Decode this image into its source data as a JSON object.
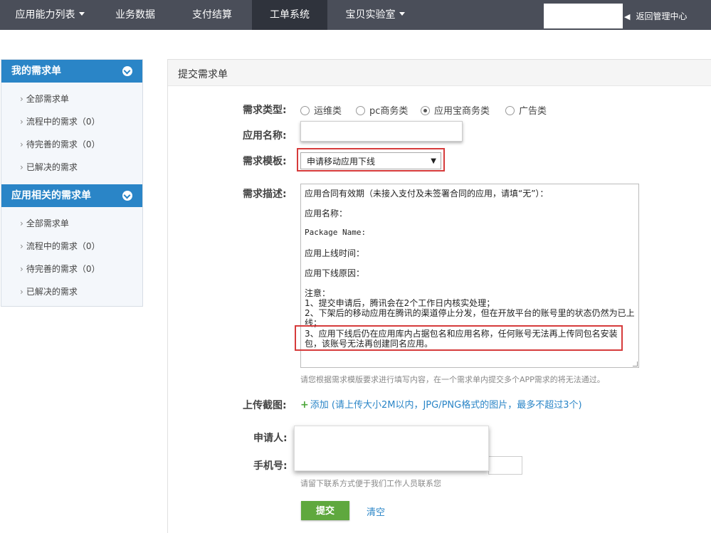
{
  "topnav": {
    "items": [
      {
        "label": "应用能力列表",
        "dropdown": true
      },
      {
        "label": "业务数据",
        "dropdown": false
      },
      {
        "label": "支付结算",
        "dropdown": false
      },
      {
        "label": "工单系统",
        "dropdown": false,
        "active": true
      },
      {
        "label": "宝贝实验室",
        "dropdown": true
      }
    ],
    "back_label": "返回管理中心"
  },
  "sidebar": {
    "groups": [
      {
        "title": "我的需求单",
        "items": [
          "全部需求单",
          "流程中的需求（0）",
          "待完善的需求（0）",
          "已解决的需求"
        ]
      },
      {
        "title": "应用相关的需求单",
        "items": [
          "全部需求单",
          "流程中的需求（0）",
          "待完善的需求（0）",
          "已解决的需求"
        ]
      }
    ]
  },
  "form": {
    "panel_title": "提交需求单",
    "type_label": "需求类型:",
    "type_options": [
      "运维类",
      "pc商务类",
      "应用宝商务类",
      "广告类"
    ],
    "type_selected": "应用宝商务类",
    "app_name_label": "应用名称:",
    "template_label": "需求模板:",
    "template_value": "申请移动应用下线",
    "desc_label": "需求描述:",
    "desc_lines": [
      "应用合同有效期（未接入支付及未签署合同的应用，请填“无”）：",
      "应用名称：",
      "Package Name:",
      "应用上线时间：",
      "应用下线原因：",
      "注意：",
      "1、提交申请后，腾讯会在2个工作日内核实处理；",
      "2、下架后的移动应用在腾讯的渠道停止分发，但在开放平台的账号里的状态仍然为已上",
      "线；",
      "3、应用下线后仍在应用库内占据包名和应用名称，任何账号无法再上传同包名安装",
      "包，该账号无法再创建同名应用。"
    ],
    "desc_hint": "请您根据需求模版要求进行填写内容，在一个需求单内提交多个APP需求的将无法通过。",
    "screenshot_label": "上传截图:",
    "add_label": "添加",
    "add_hint": "(请上传大小2M以内，JPG/PNG格式的图片，最多不超过3个)",
    "applicant_label": "申请人:",
    "phone_label": "手机号:",
    "contact_hint": "请留下联系方式便于我们工作人员联系您",
    "submit_label": "提交",
    "clear_label": "清空"
  },
  "colors": {
    "topbar": "#4a4e59",
    "topbar_active": "#2f333c",
    "sidebar_head": "#2a85c7",
    "highlight_border": "#d63b3b",
    "submit": "#5fa83e",
    "link": "#2a85c7"
  }
}
